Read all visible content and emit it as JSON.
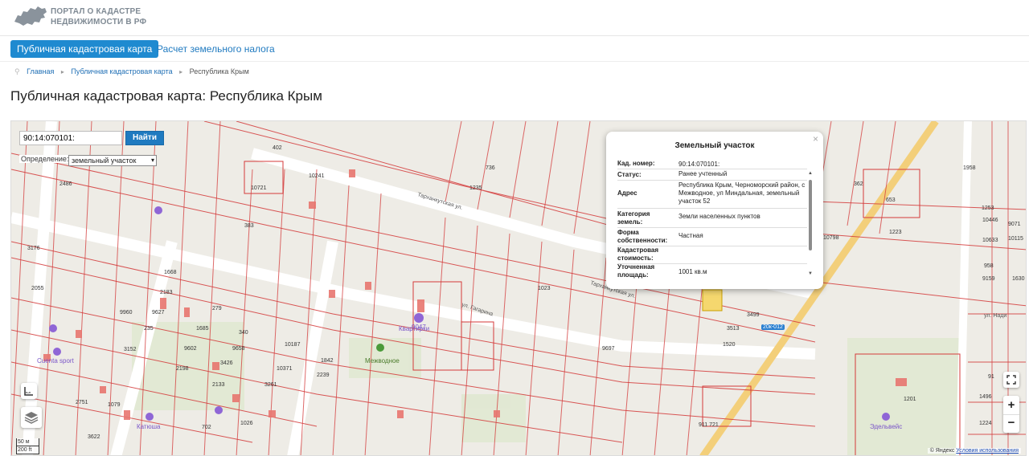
{
  "header": {
    "logo_line1": "ПОРТАЛ О КАДАСТРЕ",
    "logo_line2": "НЕДВИЖИМОСТИ В РФ",
    "logo_icon": "russia-map-icon"
  },
  "nav": {
    "tabs": [
      {
        "label": "Публичная кадастровая карта",
        "active": true
      },
      {
        "label": "Расчет земельного налога",
        "active": false
      }
    ]
  },
  "breadcrumb": {
    "items": [
      "Главная",
      "Публичная кадастровая карта",
      "Республика Крым"
    ]
  },
  "page_title": "Публичная кадастровая карта: Республика Крым",
  "map": {
    "search": {
      "value": "90:14:070101:",
      "button": "Найти"
    },
    "definition": {
      "label": "Определение:",
      "selected": "земельный участок"
    },
    "popup": {
      "title": "Земельный участок",
      "rows": [
        {
          "key": "Кад. номер:",
          "value": "90:14:070101:"
        },
        {
          "key": "Статус:",
          "value": "Ранее учтенный"
        },
        {
          "key": "Адрес",
          "value": "Республика Крым, Черноморский район, с Межводное, ул Миндальная, земельный участок 52"
        },
        {
          "key": "Категория земель:",
          "value": "Земли населенных пунктов"
        },
        {
          "key": "Форма собственности:",
          "value": "Частная"
        },
        {
          "key": "Кадастровая стоимость:",
          "value": ""
        },
        {
          "key": "Уточненная площадь:",
          "value": "1001 кв.м"
        }
      ]
    },
    "controls": {
      "zoom_in": "+",
      "zoom_out": "−",
      "fullscreen_icon": "fullscreen-icon",
      "ruler_icon": "ruler-icon",
      "layers_icon": "layers-icon"
    },
    "scale": {
      "metric": "50 м",
      "imperial": "200 ft"
    },
    "attribution": {
      "yandex": "© Яндекс",
      "terms": "Условия использования"
    },
    "poi": [
      "Квартирки",
      "Межводное",
      "Cuenta sport",
      "Катюша",
      "Эдельвейс",
      "9047",
      "20к-012",
      "911 721"
    ],
    "parcel_numbers": [
      "10721",
      "383",
      "9619",
      "402",
      "10241",
      "3225",
      "2486",
      "10563",
      "1270",
      "785",
      "10105",
      "3176",
      "1589",
      "2055",
      "1668",
      "1577",
      "510",
      "611",
      "9960",
      "9627",
      "2183",
      "9602",
      "2198",
      "3426",
      "3152",
      "2041",
      "235",
      "1685",
      "279",
      "340",
      "1420",
      "9658",
      "1624",
      "9633",
      "1098",
      "1578",
      "3247",
      "1603",
      "10187",
      "10371",
      "1842",
      "2239",
      "1884",
      "3261",
      "2133",
      "1026",
      "1795",
      "702",
      "9347",
      "1079",
      "3622",
      "2751",
      "10721",
      "1842",
      "3619",
      "1467",
      "1492",
      "1874",
      "1934",
      "2055",
      "10777",
      "1023",
      "2160",
      "9697",
      "1591",
      "1880",
      "1590",
      "3513",
      "1520",
      "3499",
      "653",
      "362",
      "2140",
      "1223",
      "10446",
      "10633",
      "958",
      "9159",
      "9071",
      "10115",
      "1976",
      "1630",
      "1201",
      "1496",
      "1224",
      "2984",
      "1773",
      "91",
      "1990",
      "1552",
      "1955",
      "2064",
      "1958",
      "1253",
      "1935",
      "10798",
      "736",
      "1235",
      "1579",
      "10598",
      "1830",
      "1098",
      "10525",
      "3658",
      "3643",
      "1541",
      "1023"
    ]
  }
}
